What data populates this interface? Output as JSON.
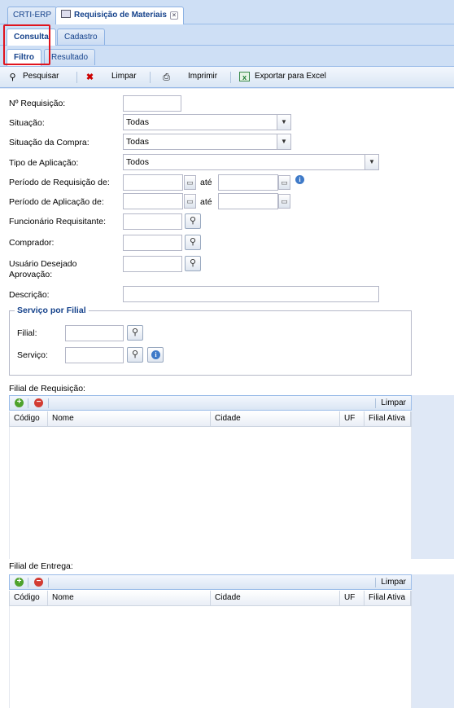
{
  "top_tabs": [
    {
      "label": "CRTI-ERP"
    },
    {
      "label": "Requisição de Materiais"
    }
  ],
  "main_tabs": [
    {
      "label": "Consulta"
    },
    {
      "label": "Cadastro"
    }
  ],
  "sub_tabs": [
    {
      "label": "Filtro"
    },
    {
      "label": "Resultado"
    }
  ],
  "toolbar": {
    "pesquisar": "Pesquisar",
    "limpar": "Limpar",
    "imprimir": "Imprimir",
    "exportar": "Exportar para Excel"
  },
  "form": {
    "nro_requisicao": {
      "label": "Nº Requisição:",
      "value": ""
    },
    "situacao": {
      "label": "Situação:",
      "value": "Todas"
    },
    "situacao_compra": {
      "label": "Situação da Compra:",
      "value": "Todas"
    },
    "tipo_aplicacao": {
      "label": "Tipo de Aplicação:",
      "value": "Todos"
    },
    "periodo_requisicao": {
      "label": "Período de Requisição de:",
      "ate": "até",
      "from": "",
      "to": ""
    },
    "periodo_aplicacao": {
      "label": "Período de Aplicação de:",
      "ate": "até",
      "from": "",
      "to": ""
    },
    "funcionario": {
      "label": "Funcionário Requisitante:",
      "value": ""
    },
    "comprador": {
      "label": "Comprador:",
      "value": ""
    },
    "usuario_aprovacao": {
      "label_line1": "Usuário Desejado",
      "label_line2": "Aprovação:",
      "value": ""
    },
    "descricao": {
      "label": "Descrição:",
      "value": ""
    }
  },
  "servico_filial": {
    "legend": "Serviço por Filial",
    "filial_label": "Filial:",
    "servico_label": "Serviço:"
  },
  "grid_requisicao": {
    "title": "Filial de Requisição:",
    "limpar": "Limpar",
    "columns": [
      "Código",
      "Nome",
      "Cidade",
      "UF",
      "Filial Ativa"
    ]
  },
  "grid_entrega": {
    "title": "Filial de Entrega:",
    "limpar": "Limpar",
    "columns": [
      "Código",
      "Nome",
      "Cidade",
      "UF",
      "Filial Ativa"
    ]
  },
  "colors": {
    "highlight": "#e0141e",
    "tab_text": "#15428b",
    "panel_bg": "#dfe8f6"
  }
}
